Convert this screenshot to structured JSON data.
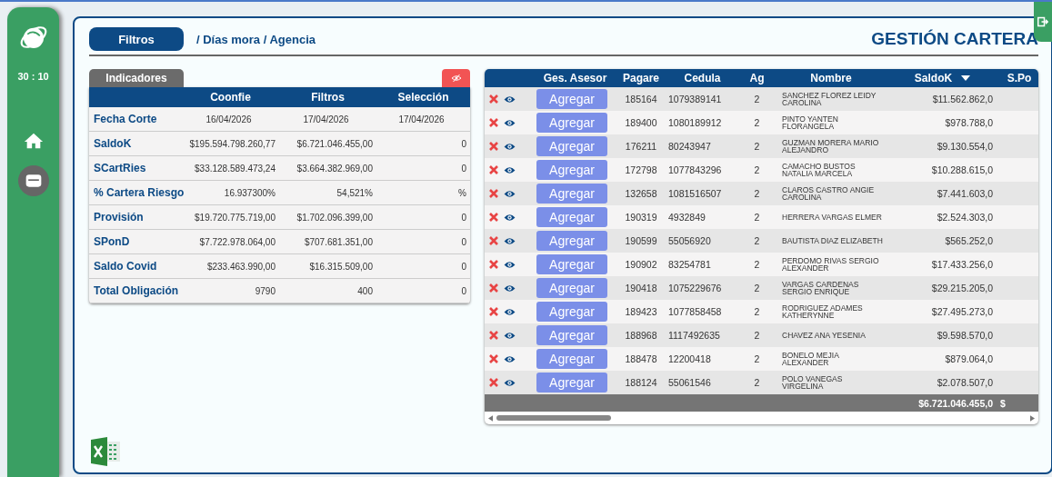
{
  "sidebar": {
    "timer": "30 : 10",
    "items": [
      {
        "kind": "home",
        "selected": false
      },
      {
        "kind": "card",
        "selected": true
      }
    ]
  },
  "header": {
    "filter_button": "Filtros",
    "breadcrumb": "/ Días mora / Agencia",
    "title": "GESTIÓN CARTERA"
  },
  "indicators": {
    "tab": "Indicadores",
    "columns": [
      "Coonfie",
      "Filtros",
      "Selección"
    ],
    "rows": [
      {
        "label": "Fecha Corte",
        "values": [
          "16/04/2026",
          "17/04/2026",
          "17/04/2026"
        ]
      },
      {
        "label": "SaldoK",
        "values": [
          "$195.594.798.260,77",
          "$6.721.046.455,00",
          "0"
        ]
      },
      {
        "label": "SCartRies",
        "values": [
          "$33.128.589.473,24",
          "$3.664.382.969,00",
          "0"
        ]
      },
      {
        "label": "% Cartera Riesgo",
        "values": [
          "16.937300%",
          "54,521%",
          "%"
        ]
      },
      {
        "label": "Provisión",
        "values": [
          "$19.720.775.719,00",
          "$1.702.096.399,00",
          "0"
        ]
      },
      {
        "label": "SPonD",
        "values": [
          "$7.722.978.064,00",
          "$707.681.351,00",
          "0"
        ]
      },
      {
        "label": "Saldo Covid",
        "values": [
          "$233.463.990,00",
          "$16.315.509,00",
          "0"
        ]
      },
      {
        "label": "Total Obligación",
        "values": [
          "9790",
          "400",
          "0"
        ]
      }
    ]
  },
  "cartera": {
    "columns": [
      {
        "label": "Ges. Asesor",
        "sorted": false
      },
      {
        "label": "Pagare",
        "sorted": false
      },
      {
        "label": "Cedula",
        "sorted": false
      },
      {
        "label": "Ag",
        "sorted": false
      },
      {
        "label": "Nombre",
        "sorted": false
      },
      {
        "label": "SaldoK",
        "sorted": true
      },
      {
        "label": "S.Po",
        "sorted": false
      }
    ],
    "rows": [
      {
        "button": "Agregar",
        "pagare": "185164",
        "cedula": "1079389141",
        "ag": "2",
        "nombre": "SANCHEZ FLOREZ LEIDY CAROLINA",
        "saldo": "$11.562.862,0"
      },
      {
        "button": "Agregar",
        "pagare": "189400",
        "cedula": "1080189912",
        "ag": "2",
        "nombre": "PINTO YANTEN FLORANGELA",
        "saldo": "$978.788,0"
      },
      {
        "button": "Agregar",
        "pagare": "176211",
        "cedula": "80243947",
        "ag": "2",
        "nombre": "GUZMAN MORERA MARIO ALEJANDRO",
        "saldo": "$9.130.554,0"
      },
      {
        "button": "Agregar",
        "pagare": "172798",
        "cedula": "1077843296",
        "ag": "2",
        "nombre": "CAMACHO BUSTOS NATALIA MARCELA",
        "saldo": "$10.288.615,0"
      },
      {
        "button": "Agregar",
        "pagare": "132658",
        "cedula": "1081516507",
        "ag": "2",
        "nombre": "CLAROS CASTRO ANGIE CAROLINA",
        "saldo": "$7.441.603,0"
      },
      {
        "button": "Agregar",
        "pagare": "190319",
        "cedula": "4932849",
        "ag": "2",
        "nombre": "HERRERA VARGAS ELMER",
        "saldo": "$2.524.303,0"
      },
      {
        "button": "Agregar",
        "pagare": "190599",
        "cedula": "55056920",
        "ag": "2",
        "nombre": "BAUTISTA DIAZ ELIZABETH",
        "saldo": "$565.252,0"
      },
      {
        "button": "Agregar",
        "pagare": "190902",
        "cedula": "83254781",
        "ag": "2",
        "nombre": "PERDOMO RIVAS SERGIO ALEXANDER",
        "saldo": "$17.433.256,0"
      },
      {
        "button": "Agregar",
        "pagare": "190418",
        "cedula": "1075229676",
        "ag": "2",
        "nombre": "VARGAS CARDENAS SERGIO ENRIQUE",
        "saldo": "$29.215.205,0"
      },
      {
        "button": "Agregar",
        "pagare": "189423",
        "cedula": "1077858458",
        "ag": "2",
        "nombre": "RODRIGUEZ ADAMES KATHERYNNE",
        "saldo": "$27.495.273,0"
      },
      {
        "button": "Agregar",
        "pagare": "188968",
        "cedula": "1117492635",
        "ag": "2",
        "nombre": "CHAVEZ ANA YESENIA",
        "saldo": "$9.598.570,0"
      },
      {
        "button": "Agregar",
        "pagare": "188478",
        "cedula": "12200418",
        "ag": "2",
        "nombre": "BONELO MEJIA ALEXANDER",
        "saldo": "$879.064,0"
      },
      {
        "button": "Agregar",
        "pagare": "188124",
        "cedula": "55061546",
        "ag": "2",
        "nombre": "POLO VANEGAS VIRGELINA",
        "saldo": "$2.078.507,0"
      }
    ],
    "footer": {
      "saldo": "$6.721.046.455,0",
      "column_8": "$"
    }
  }
}
